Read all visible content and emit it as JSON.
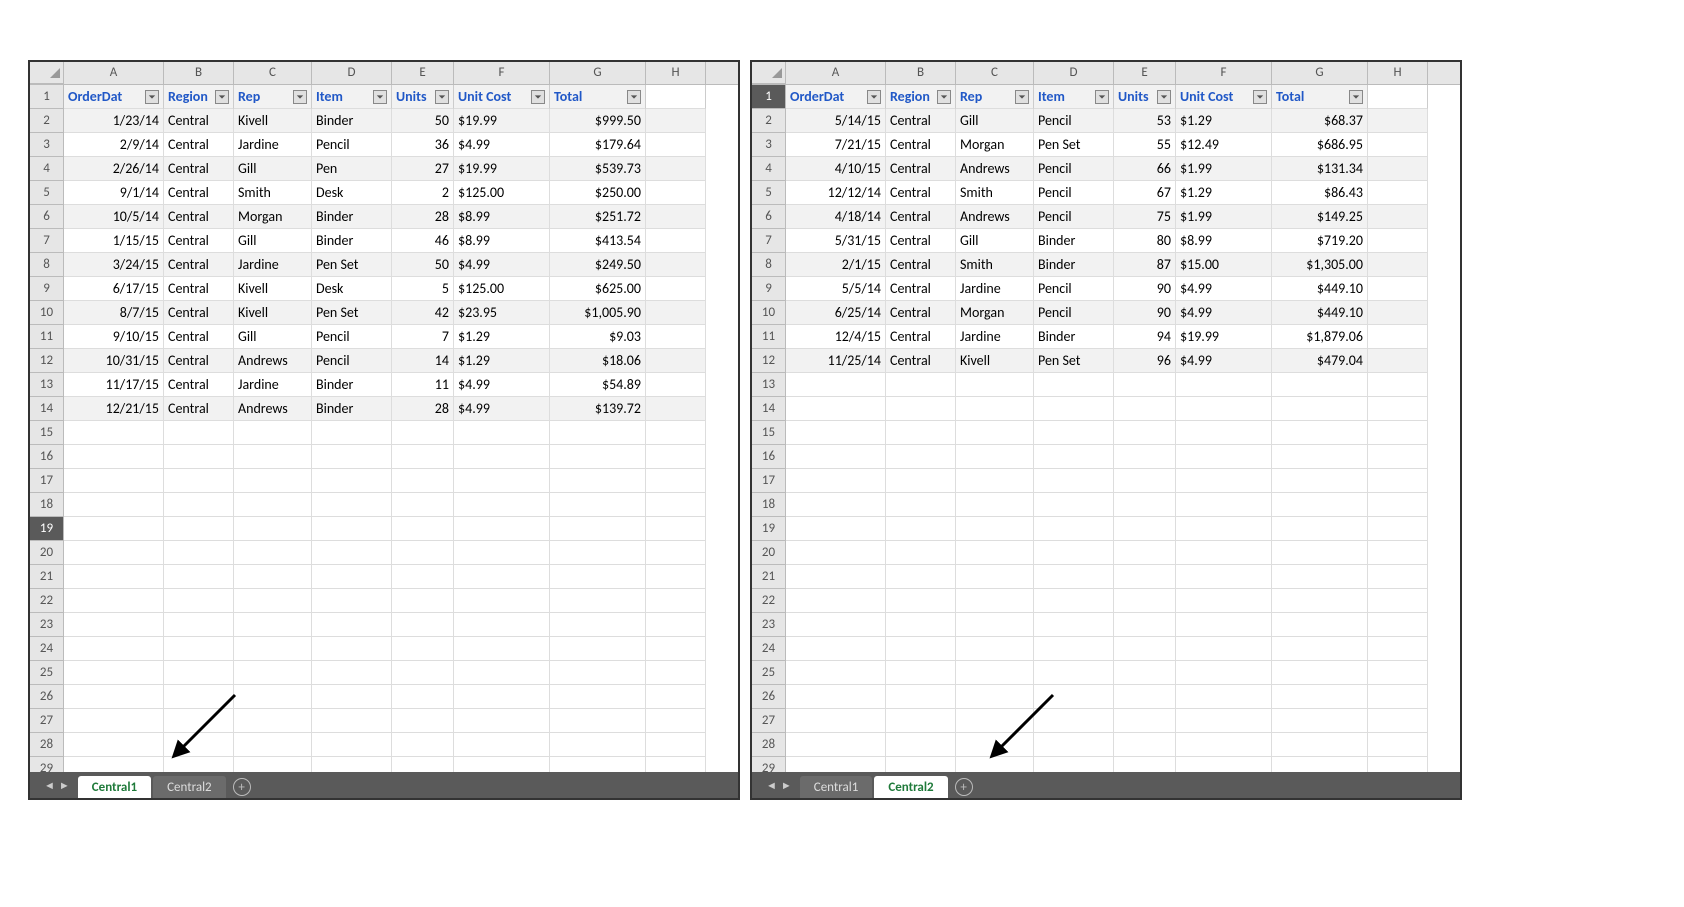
{
  "colWidths": {
    "A": 100,
    "B": 70,
    "C": 78,
    "D": 80,
    "E": 62,
    "F": 96,
    "G": 96,
    "H": 60
  },
  "columns": [
    "A",
    "B",
    "C",
    "D",
    "E",
    "F",
    "G",
    "H"
  ],
  "headers": [
    "OrderDat",
    "Region",
    "Rep",
    "Item",
    "Units",
    "Unit Cost",
    "Total"
  ],
  "rowCount": 29,
  "pane1": {
    "activeTab": "Central1",
    "tabs": [
      "Central1",
      "Central2"
    ],
    "selectedRow": 19,
    "rows": [
      {
        "A": "1/23/14",
        "B": "Central",
        "C": "Kivell",
        "D": "Binder",
        "E": "50",
        "F": "$19.99",
        "G": "$999.50"
      },
      {
        "A": "2/9/14",
        "B": "Central",
        "C": "Jardine",
        "D": "Pencil",
        "E": "36",
        "F": "$4.99",
        "G": "$179.64"
      },
      {
        "A": "2/26/14",
        "B": "Central",
        "C": "Gill",
        "D": "Pen",
        "E": "27",
        "F": "$19.99",
        "G": "$539.73"
      },
      {
        "A": "9/1/14",
        "B": "Central",
        "C": "Smith",
        "D": "Desk",
        "E": "2",
        "F": "$125.00",
        "G": "$250.00"
      },
      {
        "A": "10/5/14",
        "B": "Central",
        "C": "Morgan",
        "D": "Binder",
        "E": "28",
        "F": "$8.99",
        "G": "$251.72"
      },
      {
        "A": "1/15/15",
        "B": "Central",
        "C": "Gill",
        "D": "Binder",
        "E": "46",
        "F": "$8.99",
        "G": "$413.54"
      },
      {
        "A": "3/24/15",
        "B": "Central",
        "C": "Jardine",
        "D": "Pen Set",
        "E": "50",
        "F": "$4.99",
        "G": "$249.50"
      },
      {
        "A": "6/17/15",
        "B": "Central",
        "C": "Kivell",
        "D": "Desk",
        "E": "5",
        "F": "$125.00",
        "G": "$625.00"
      },
      {
        "A": "8/7/15",
        "B": "Central",
        "C": "Kivell",
        "D": "Pen Set",
        "E": "42",
        "F": "$23.95",
        "G": "$1,005.90"
      },
      {
        "A": "9/10/15",
        "B": "Central",
        "C": "Gill",
        "D": "Pencil",
        "E": "7",
        "F": "$1.29",
        "G": "$9.03"
      },
      {
        "A": "10/31/15",
        "B": "Central",
        "C": "Andrews",
        "D": "Pencil",
        "E": "14",
        "F": "$1.29",
        "G": "$18.06"
      },
      {
        "A": "11/17/15",
        "B": "Central",
        "C": "Jardine",
        "D": "Binder",
        "E": "11",
        "F": "$4.99",
        "G": "$54.89"
      },
      {
        "A": "12/21/15",
        "B": "Central",
        "C": "Andrews",
        "D": "Binder",
        "E": "28",
        "F": "$4.99",
        "G": "$139.72"
      }
    ]
  },
  "pane2": {
    "activeTab": "Central2",
    "tabs": [
      "Central1",
      "Central2"
    ],
    "selectedRow": 1,
    "rows": [
      {
        "A": "5/14/15",
        "B": "Central",
        "C": "Gill",
        "D": "Pencil",
        "E": "53",
        "F": "$1.29",
        "G": "$68.37"
      },
      {
        "A": "7/21/15",
        "B": "Central",
        "C": "Morgan",
        "D": "Pen Set",
        "E": "55",
        "F": "$12.49",
        "G": "$686.95"
      },
      {
        "A": "4/10/15",
        "B": "Central",
        "C": "Andrews",
        "D": "Pencil",
        "E": "66",
        "F": "$1.99",
        "G": "$131.34"
      },
      {
        "A": "12/12/14",
        "B": "Central",
        "C": "Smith",
        "D": "Pencil",
        "E": "67",
        "F": "$1.29",
        "G": "$86.43"
      },
      {
        "A": "4/18/14",
        "B": "Central",
        "C": "Andrews",
        "D": "Pencil",
        "E": "75",
        "F": "$1.99",
        "G": "$149.25"
      },
      {
        "A": "5/31/15",
        "B": "Central",
        "C": "Gill",
        "D": "Binder",
        "E": "80",
        "F": "$8.99",
        "G": "$719.20"
      },
      {
        "A": "2/1/15",
        "B": "Central",
        "C": "Smith",
        "D": "Binder",
        "E": "87",
        "F": "$15.00",
        "G": "$1,305.00"
      },
      {
        "A": "5/5/14",
        "B": "Central",
        "C": "Jardine",
        "D": "Pencil",
        "E": "90",
        "F": "$4.99",
        "G": "$449.10"
      },
      {
        "A": "6/25/14",
        "B": "Central",
        "C": "Morgan",
        "D": "Pencil",
        "E": "90",
        "F": "$4.99",
        "G": "$449.10"
      },
      {
        "A": "12/4/15",
        "B": "Central",
        "C": "Jardine",
        "D": "Binder",
        "E": "94",
        "F": "$19.99",
        "G": "$1,879.06"
      },
      {
        "A": "11/25/14",
        "B": "Central",
        "C": "Kivell",
        "D": "Pen Set",
        "E": "96",
        "F": "$4.99",
        "G": "$479.04"
      }
    ]
  },
  "chart_data": {
    "type": "table",
    "sheets": [
      {
        "name": "Central1",
        "columns": [
          "OrderDate",
          "Region",
          "Rep",
          "Item",
          "Units",
          "Unit Cost",
          "Total"
        ],
        "rows": [
          [
            "1/23/14",
            "Central",
            "Kivell",
            "Binder",
            50,
            19.99,
            999.5
          ],
          [
            "2/9/14",
            "Central",
            "Jardine",
            "Pencil",
            36,
            4.99,
            179.64
          ],
          [
            "2/26/14",
            "Central",
            "Gill",
            "Pen",
            27,
            19.99,
            539.73
          ],
          [
            "9/1/14",
            "Central",
            "Smith",
            "Desk",
            2,
            125.0,
            250.0
          ],
          [
            "10/5/14",
            "Central",
            "Morgan",
            "Binder",
            28,
            8.99,
            251.72
          ],
          [
            "1/15/15",
            "Central",
            "Gill",
            "Binder",
            46,
            8.99,
            413.54
          ],
          [
            "3/24/15",
            "Central",
            "Jardine",
            "Pen Set",
            50,
            4.99,
            249.5
          ],
          [
            "6/17/15",
            "Central",
            "Kivell",
            "Desk",
            5,
            125.0,
            625.0
          ],
          [
            "8/7/15",
            "Central",
            "Kivell",
            "Pen Set",
            42,
            23.95,
            1005.9
          ],
          [
            "9/10/15",
            "Central",
            "Gill",
            "Pencil",
            7,
            1.29,
            9.03
          ],
          [
            "10/31/15",
            "Central",
            "Andrews",
            "Pencil",
            14,
            1.29,
            18.06
          ],
          [
            "11/17/15",
            "Central",
            "Jardine",
            "Binder",
            11,
            4.99,
            54.89
          ],
          [
            "12/21/15",
            "Central",
            "Andrews",
            "Binder",
            28,
            4.99,
            139.72
          ]
        ]
      },
      {
        "name": "Central2",
        "columns": [
          "OrderDate",
          "Region",
          "Rep",
          "Item",
          "Units",
          "Unit Cost",
          "Total"
        ],
        "rows": [
          [
            "5/14/15",
            "Central",
            "Gill",
            "Pencil",
            53,
            1.29,
            68.37
          ],
          [
            "7/21/15",
            "Central",
            "Morgan",
            "Pen Set",
            55,
            12.49,
            686.95
          ],
          [
            "4/10/15",
            "Central",
            "Andrews",
            "Pencil",
            66,
            1.99,
            131.34
          ],
          [
            "12/12/14",
            "Central",
            "Smith",
            "Pencil",
            67,
            1.29,
            86.43
          ],
          [
            "4/18/14",
            "Central",
            "Andrews",
            "Pencil",
            75,
            1.99,
            149.25
          ],
          [
            "5/31/15",
            "Central",
            "Gill",
            "Binder",
            80,
            8.99,
            719.2
          ],
          [
            "2/1/15",
            "Central",
            "Smith",
            "Binder",
            87,
            15.0,
            1305.0
          ],
          [
            "5/5/14",
            "Central",
            "Jardine",
            "Pencil",
            90,
            4.99,
            449.1
          ],
          [
            "6/25/14",
            "Central",
            "Morgan",
            "Pencil",
            90,
            4.99,
            449.1
          ],
          [
            "12/4/15",
            "Central",
            "Jardine",
            "Binder",
            94,
            19.99,
            1879.06
          ],
          [
            "11/25/14",
            "Central",
            "Kivell",
            "Pen Set",
            96,
            4.99,
            479.04
          ]
        ]
      }
    ]
  }
}
